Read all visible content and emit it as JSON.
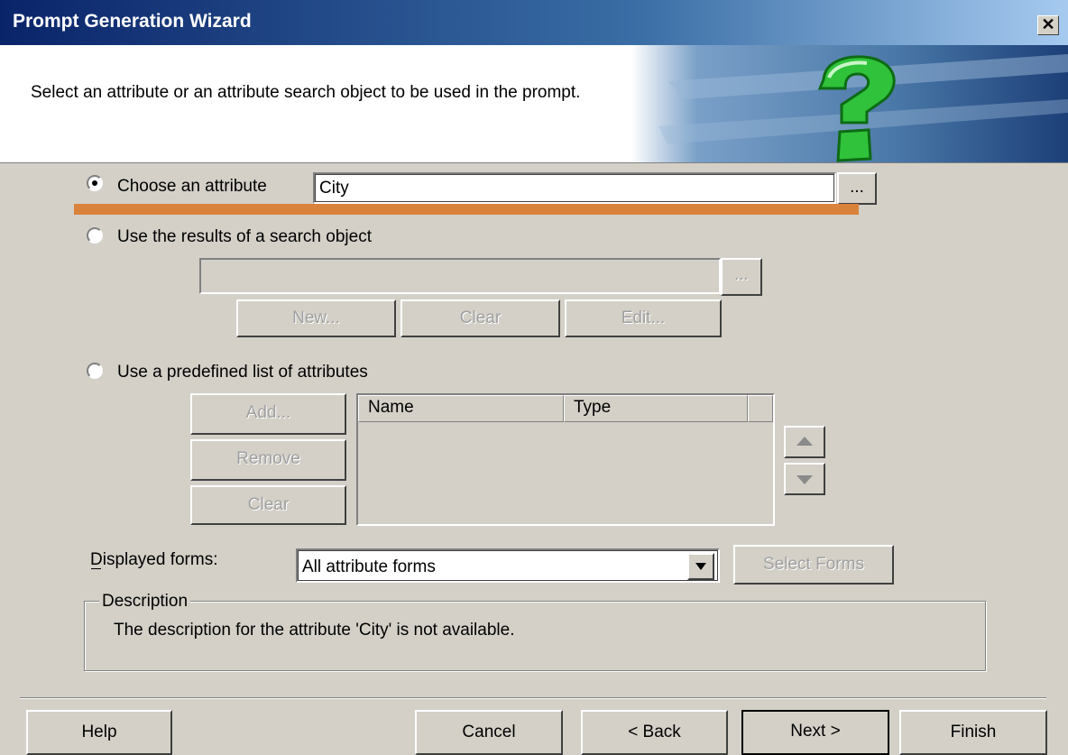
{
  "window": {
    "title": "Prompt Generation Wizard",
    "close_glyph": "✕"
  },
  "header": {
    "message": "Select an attribute or an attribute search object to be used in the prompt."
  },
  "option_attribute": {
    "label": "Choose an attribute",
    "value": "City",
    "browse": "...",
    "selected": true
  },
  "option_search": {
    "label": "Use the results of a search object",
    "value": "",
    "browse": "...",
    "new_label": "New...",
    "clear_label": "Clear",
    "edit_label": "Edit..."
  },
  "option_list": {
    "label": "Use a predefined list of attributes",
    "add_label": "Add...",
    "remove_label": "Remove",
    "clear_label": "Clear",
    "columns": [
      "Name",
      "Type"
    ]
  },
  "forms": {
    "label": "Displayed forms:",
    "value": "All attribute forms",
    "select_label": "Select Forms"
  },
  "description": {
    "legend": "Description",
    "text": "The description for the attribute 'City' is not available."
  },
  "footer": {
    "help": "Help",
    "cancel": "Cancel",
    "back": "< Back",
    "next": "Next >",
    "finish": "Finish"
  },
  "colors": {
    "title_bar": "#0a246a",
    "highlight_bar": "#d9823b",
    "dialog_bg": "#d4d0c8"
  },
  "icons": [
    "close-icon",
    "question-mark-icon",
    "radio-selected-icon",
    "arrow-up-icon",
    "arrow-down-icon",
    "dropdown-arrow-icon"
  ]
}
